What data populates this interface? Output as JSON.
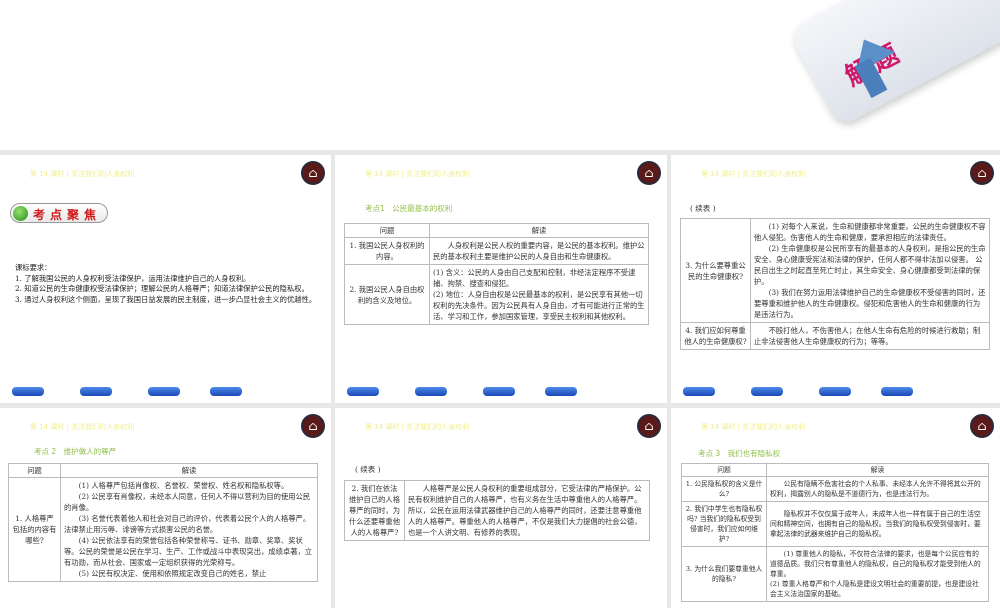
{
  "logo_text": "解题",
  "lesson_title": "第 14 课时 | 关注我们的人身权利",
  "slide1": {
    "badge": "考点聚焦",
    "req_title": "课标要求：",
    "req": [
      "1. 了解我国公民的人身权利受法律保护，运用法律维护自己的人身权利。",
      "2. 知道公民的生命健康权受法律保护；理解公民的人格尊严；知道法律保护公民的隐私权。",
      "3. 通过人身权利这个侧面，呈现了我国日益发展的民主制度，进一步凸显社会主义的优越性。"
    ]
  },
  "header": {
    "q": "问题",
    "a": "解读"
  },
  "slide2": {
    "sub": "考点1　公民最基本的权利",
    "rows": [
      {
        "q": "1. 我国公民人身权利的内容。",
        "a": [
          "人身权利是公民人权的重要内容，是公民的基本权利。维护公民的基本权利主要是维护公民的人身自由和生命健康权。"
        ]
      },
      {
        "q": "2. 我国公民人身自由权利的含义及地位。",
        "a": [
          "(1) 含义：公民的人身由自己支配和控制，非经法定程序不受逮捕、拘禁、搜查和侵犯。",
          "(2) 地位：人身自由权是公民最基本的权利，是公民享有其他一切权利的先决条件。因为公民具有人身自由，才有可能进行正常的生活、学习和工作，参加国家管理，享受民主权利和其他权利。"
        ]
      }
    ]
  },
  "slide3": {
    "cont": "( 续表 )",
    "rows": [
      {
        "q": "3. 为什么要尊重公民的生命健康权?",
        "a": [
          "(1) 对每个人来说，生命和健康都非常重要，公民的生命健康权不容他人侵犯。伤害他人的生命和健康，要承担相应的法律责任。",
          "(2) 生命健康权是公民所享有的最基本的人身权利，是指公民的生命安全、身心健康受宪法和法律的保护，任何人都不得非法加以侵害。 公民自出生之时起直至死亡时止，其生命安全、身心健康都受到法律的保护。",
          "(3) 我们在努力运用法律维护自己的生命健康权不受侵害的同时，还要尊重和维护他人的生命健康权。侵犯和危害他人的生命和健康的行为是违法行为。"
        ]
      },
      {
        "q": "4. 我们应如何尊重他人的生命健康权?",
        "a": [
          "不殴打他人，不伤害他人；在他人生命有危险的时候进行救助；制止非法侵害他人生命健康权的行为；等等。"
        ]
      }
    ]
  },
  "slide4": {
    "sub": "考点 2　维护做人的尊严",
    "rows": [
      {
        "q": "1. 人格尊严包括的内容有哪些?",
        "a": [
          "(1) 人格尊严包括肖像权、名誉权、荣誉权、姓名权和隐私权等。",
          "(2) 公民享有肖像权，未经本人同意，任何人不得以营利为目的使用公民的肖像。",
          "(3) 名誉代表着他人和社会对自己的评价，代表着公民个人的人格尊严。法律禁止用污辱、诽谤等方式损害公民的名誉。",
          "(4) 公民依法享有的荣誉包括各种荣誉称号、证书、勋章、奖章、奖状等。公民的荣誉是公民在学习、生产、工作或战斗中表现突出，成绩卓著，立有功勋，而从社会、国家或一定组织获得的光荣称号。",
          "(5) 公民有权决定、使用和依照规定改变自己的姓名，禁止"
        ]
      }
    ]
  },
  "slide5": {
    "cont": "( 续表 )",
    "rows": [
      {
        "q": "2. 我们在依法维护自己的人格尊严的同时，为什么还要尊重他人的人格尊严?",
        "a": [
          "人格尊严是公民人身权利的重要组成部分，它受法律的严格保护。公民有权利维护自己的人格尊严，也有义务在生活中尊重他人的人格尊严。所以，公民在运用法律武器维护自己的人格尊严的同时，还要注意尊重他人的人格尊严。尊重他人的人格尊严，不仅是我们大力提倡的社会公德，也是一个人讲文明、有修养的表现。"
        ]
      }
    ]
  },
  "slide6": {
    "sub": "考点 3　我们也有隐私权",
    "rows": [
      {
        "q": "1. 公民隐私权的含义是什么?",
        "a": [
          "公民有隐瞒不危害社会的个人私事、未经本人允许不得将其公开的权利，揭露别人的隐私是不道德行为，也是违法行为。"
        ]
      },
      {
        "q": "2. 我们中学生也有隐私权吗? 当我们的隐私权受到侵害时，我们应如何维护?",
        "a": [
          "隐私权并不仅仅属于成年人，未成年人也一样有属于自己的生活空间和精神空间，也拥有自己的隐私权。当我们的隐私权受到侵害时，要拿起法律的武器来维护自己的隐私权。"
        ]
      },
      {
        "q": "3. 为什么我们要尊重他人的隐私?",
        "a": [
          "(1) 尊重他人的隐私，不仅符合法律的要求，也是每个公民应有的道德品质。我们只有尊重他人的隐私权，自己的隐私权才能受到他人的尊重。",
          "(2) 尊重人格尊严和个人隐私是建设文明社会的重要前提，也是建设社会主义法治国家的基础。"
        ]
      }
    ]
  }
}
